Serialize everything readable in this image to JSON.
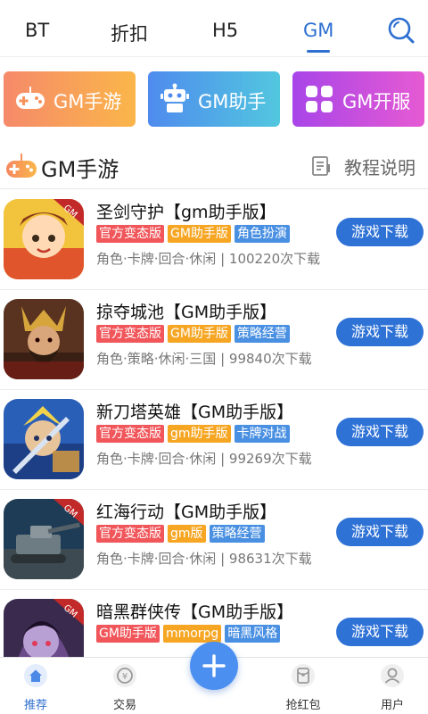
{
  "top_tabs": {
    "items": [
      {
        "label": "BT",
        "active": false
      },
      {
        "label": "折扣",
        "active": false
      },
      {
        "label": "H5",
        "active": false
      },
      {
        "label": "GM",
        "active": true
      }
    ],
    "search_icon": "search-icon",
    "accent_color": "#2e6fd0"
  },
  "categories": [
    {
      "label": "GM手游",
      "icon": "gamepad-icon",
      "gradient": [
        "#f58a6a",
        "#fbb64a"
      ]
    },
    {
      "label": "GM助手",
      "icon": "robot-icon",
      "gradient": [
        "#4f8bee",
        "#52c7df"
      ]
    },
    {
      "label": "GM开服",
      "icon": "grid-icon",
      "gradient": [
        "#a845e8",
        "#e65ad3"
      ]
    }
  ],
  "section": {
    "title": "GM手游",
    "icon": "gamepad-icon",
    "tutorial_label": "教程说明",
    "tutorial_icon": "document-icon"
  },
  "games": [
    {
      "name": "圣剑守护【gm助手版】",
      "tags": [
        {
          "text": "官方变态版",
          "color": "#f0565a"
        },
        {
          "text": "GM助手版",
          "color": "#f6a623"
        },
        {
          "text": "角色扮演",
          "color": "#4a90e2"
        }
      ],
      "meta": "角色·卡牌·回合·休闲 | 100220次下载",
      "button": "游戏下载"
    },
    {
      "name": "掠夺城池【GM助手版】",
      "tags": [
        {
          "text": "官方变态版",
          "color": "#f0565a"
        },
        {
          "text": "GM助手版",
          "color": "#f6a623"
        },
        {
          "text": "策略经营",
          "color": "#4a90e2"
        }
      ],
      "meta": "角色·策略·休闲·三国 | 99840次下载",
      "button": "游戏下载"
    },
    {
      "name": "新刀塔英雄【GM助手版】",
      "tags": [
        {
          "text": "官方变态版",
          "color": "#f0565a"
        },
        {
          "text": "gm助手版",
          "color": "#f6a623"
        },
        {
          "text": "卡牌对战",
          "color": "#4a90e2"
        }
      ],
      "meta": "角色·卡牌·回合·休闲 | 99269次下载",
      "button": "游戏下载"
    },
    {
      "name": "红海行动【GM助手版】",
      "tags": [
        {
          "text": "官方变态版",
          "color": "#f0565a"
        },
        {
          "text": "gm版",
          "color": "#f6a623"
        },
        {
          "text": "策略经营",
          "color": "#4a90e2"
        }
      ],
      "meta": "角色·卡牌·回合·休闲 | 98631次下载",
      "button": "游戏下载"
    },
    {
      "name": "暗黑群侠传【GM助手版】",
      "tags": [
        {
          "text": "GM助手版",
          "color": "#f0565a"
        },
        {
          "text": "mmorpg",
          "color": "#f6a623"
        },
        {
          "text": "暗黑风格",
          "color": "#4a90e2"
        }
      ],
      "meta": "",
      "button": "游戏下载"
    }
  ],
  "bottom_nav": {
    "items": [
      {
        "label": "推荐",
        "icon": "home-icon",
        "active": true
      },
      {
        "label": "交易",
        "icon": "coin-icon",
        "active": false
      },
      {
        "label": "抢红包",
        "icon": "red-packet-icon",
        "active": false
      },
      {
        "label": "用户",
        "icon": "user-icon",
        "active": false
      }
    ],
    "center_icon": "plus-icon"
  }
}
